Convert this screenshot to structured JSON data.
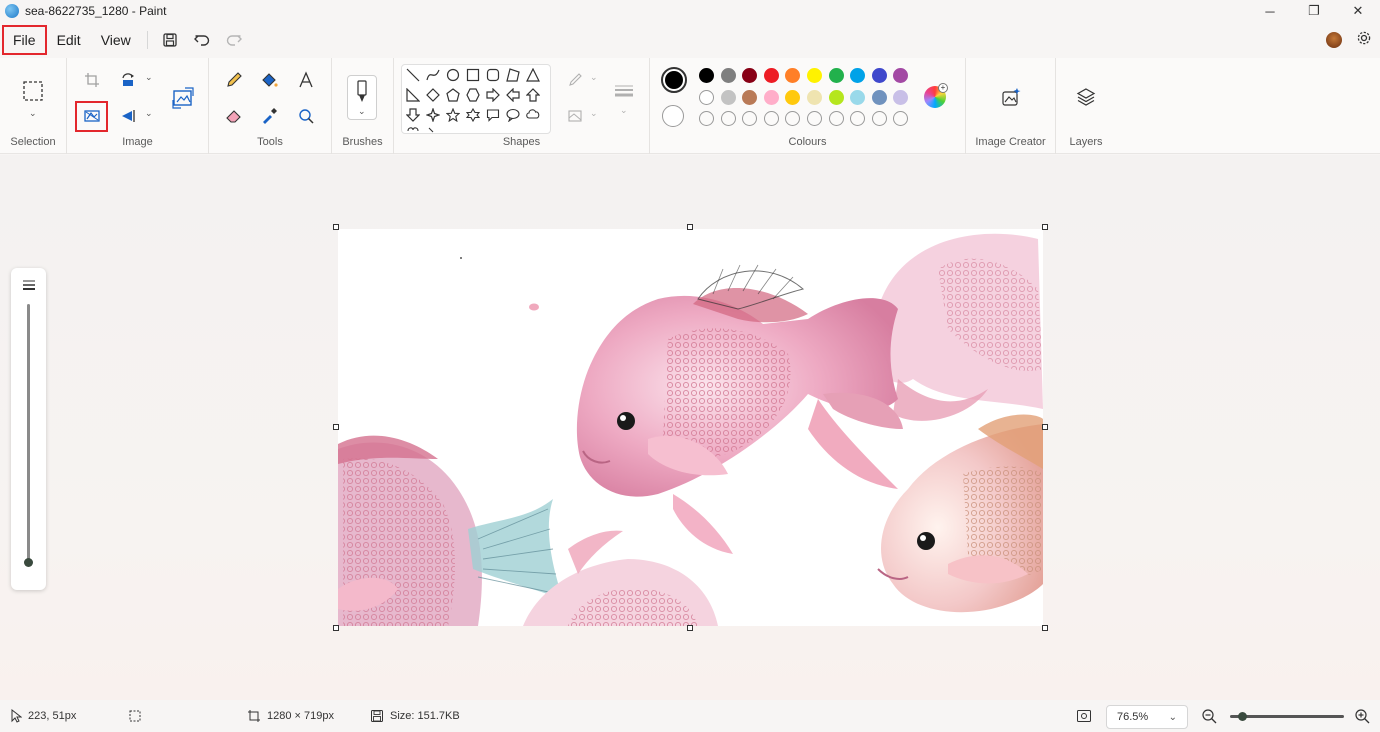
{
  "window": {
    "title": "sea-8622735_1280 - Paint",
    "controls": {
      "minimize": "─",
      "restore": "❐",
      "close": "✕"
    }
  },
  "menu": {
    "file": "File",
    "edit": "Edit",
    "view": "View"
  },
  "ribbon": {
    "groups": {
      "selection": "Selection",
      "image": "Image",
      "tools": "Tools",
      "brushes": "Brushes",
      "shapes": "Shapes",
      "colours": "Colours",
      "image_creator": "Image Creator",
      "layers": "Layers"
    },
    "colours": {
      "primary": "#000000",
      "secondary": "#ffffff",
      "row1": [
        "#000000",
        "#7f7f7f",
        "#880015",
        "#ed1c24",
        "#ff7f27",
        "#fff200",
        "#22b14c",
        "#00a2e8",
        "#3f48cc",
        "#a349a4"
      ],
      "row2": [
        "#ffffff",
        "#c3c3c3",
        "#b97a57",
        "#ffaec9",
        "#ffc90e",
        "#efe4b0",
        "#b5e61d",
        "#99d9ea",
        "#7092be",
        "#c8bfe7"
      ],
      "row3_empty_count": 10
    }
  },
  "status": {
    "cursor_position": "223, 51px",
    "canvas_size": "1280 × 719px",
    "file_size": "Size: 151.7KB",
    "zoom": "76.5%"
  },
  "accent": "#e3272d"
}
